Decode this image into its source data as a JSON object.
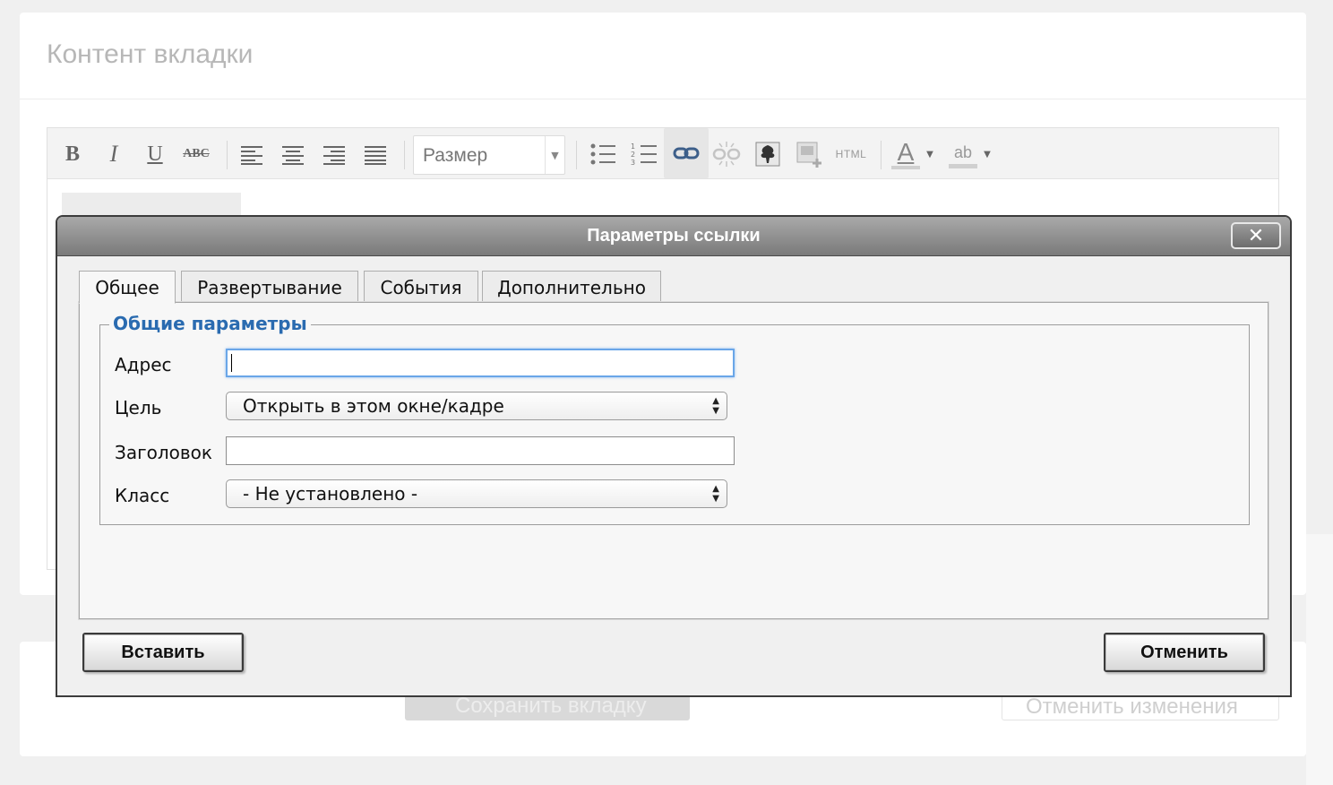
{
  "page": {
    "card_title": "Контент вкладки",
    "save_tab_label": "Сохранить вкладку",
    "revert_label": "Отменить изменения"
  },
  "toolbar": {
    "bold": "B",
    "italic": "I",
    "underline": "U",
    "strike": "ABC",
    "size_label": "Размер",
    "html": "HTML",
    "font_color": "A",
    "bg_color": "ab"
  },
  "dialog": {
    "title": "Параметры ссылки",
    "close": "✕",
    "tabs": [
      "Общее",
      "Развертывание",
      "События",
      "Дополнительно"
    ],
    "legend": "Общие параметры",
    "fields": {
      "address_label": "Адрес",
      "address_value": "",
      "target_label": "Цель",
      "target_value": "Открыть в этом окне/кадре",
      "title_label": "Заголовок",
      "title_value": "",
      "class_label": "Класс",
      "class_value": "- Не установлено -"
    },
    "insert_button": "Вставить",
    "cancel_button": "Отменить"
  }
}
